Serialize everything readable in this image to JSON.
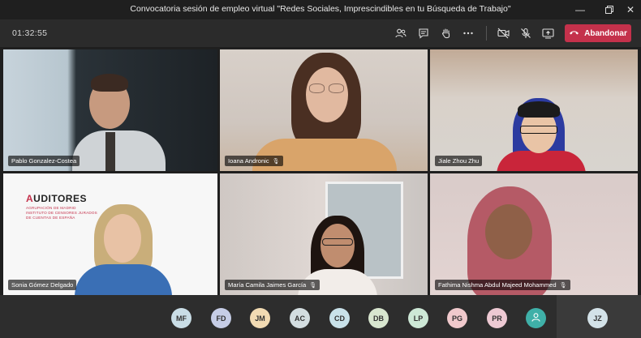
{
  "window": {
    "title": "Convocatoria sesión de empleo virtual \"Redes Sociales, Imprescindibles en tu Búsqueda de Trabajo\"",
    "controls": [
      "minimize-icon",
      "maximize-icon",
      "close-icon"
    ]
  },
  "toolbar": {
    "timer": "01:32:55",
    "icons": [
      "participants-icon",
      "chat-icon",
      "raise-hand-icon",
      "more-icon",
      "camera-off-icon",
      "mic-off-icon",
      "share-screen-icon"
    ],
    "leave_label": "Abandonar",
    "leave_color": "#c4314b"
  },
  "participants": [
    {
      "name": "Pablo Gonzalez-Costea",
      "muted": false
    },
    {
      "name": "Ioana Andronic",
      "muted": true
    },
    {
      "name": "Jiale Zhou Zhu",
      "muted": false
    },
    {
      "name": "Sonia Gómez Delgado",
      "muted": false
    },
    {
      "name": "María Camila Jaimes García",
      "muted": true
    },
    {
      "name": "Fathima Nishma Abdul Majeed Mohammed",
      "muted": true
    }
  ],
  "background_brand": {
    "logo": "AUDITORES",
    "lines": [
      "AGRUPACIÓN DE MADRID",
      "INSTITUTO DE CENSORES JURADOS",
      "DE CUENTAS DE ESPAÑA"
    ]
  },
  "roster": [
    {
      "initials": "MF",
      "color": "#c9dde6"
    },
    {
      "initials": "FD",
      "color": "#c6cde6"
    },
    {
      "initials": "JM",
      "color": "#f2dbb3"
    },
    {
      "initials": "AC",
      "color": "#d3dde0"
    },
    {
      "initials": "CD",
      "color": "#c9e2ea"
    },
    {
      "initials": "DB",
      "color": "#d8e6cf"
    },
    {
      "initials": "LP",
      "color": "#cde8d6"
    },
    {
      "initials": "PG",
      "color": "#f0c9cc"
    },
    {
      "initials": "PR",
      "color": "#edc9d3"
    },
    {
      "initials": "",
      "color": "#3fb0a8",
      "icon": "person-icon"
    },
    {
      "initials": "JZ",
      "color": "#d3e2e8"
    }
  ]
}
